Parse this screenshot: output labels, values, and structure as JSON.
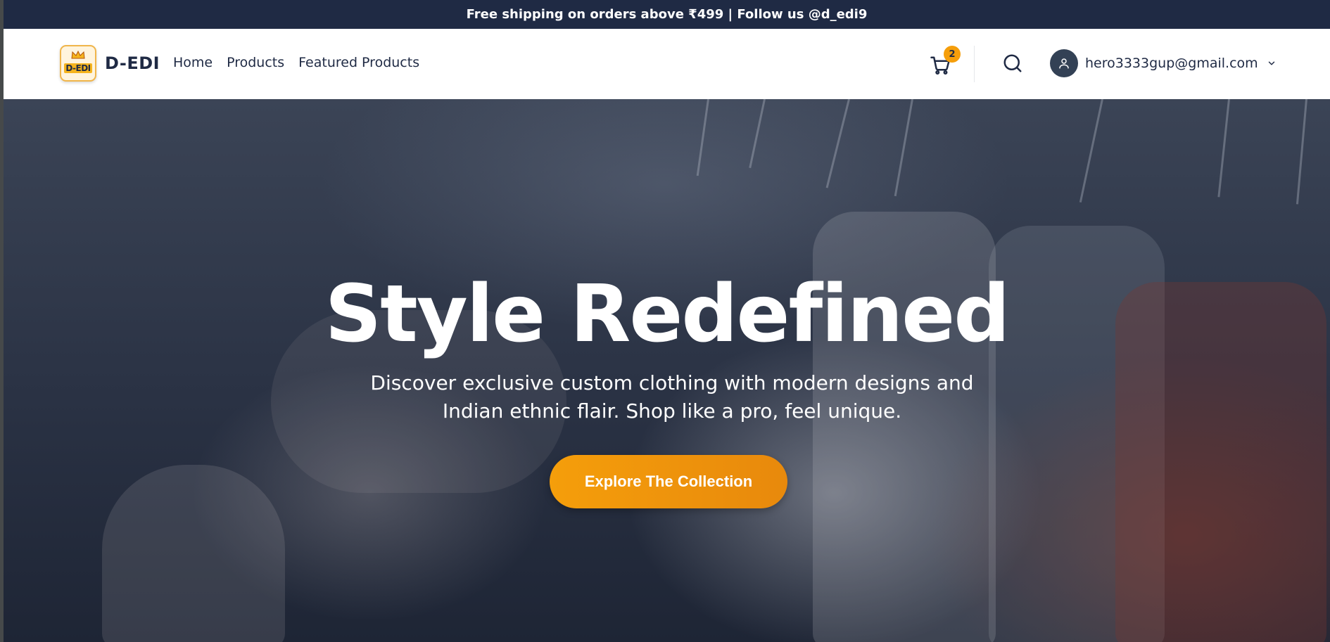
{
  "announcement": "Free shipping on orders above ₹499 | Follow us @d_edi9",
  "brand": {
    "logo_text": "D-EDI",
    "name": "D-EDI"
  },
  "nav": {
    "links": [
      "Home",
      "Products",
      "Featured Products"
    ]
  },
  "cart": {
    "icon": "cart-icon",
    "count": "2"
  },
  "search": {
    "icon": "search-icon"
  },
  "account": {
    "icon": "user-icon",
    "email": "hero3333gup@gmail.com",
    "menu_icon": "chevron-down-icon"
  },
  "hero": {
    "title": "Style Redefined",
    "subtitle": "Discover exclusive custom clothing with modern designs and Indian ethnic flair. Shop like a pro, feel unique.",
    "cta_label": "Explore The Collection"
  },
  "colors": {
    "announcement_bg": "#1f2a44",
    "accent": "#f59e0b",
    "text_dark": "#1f2a44"
  }
}
